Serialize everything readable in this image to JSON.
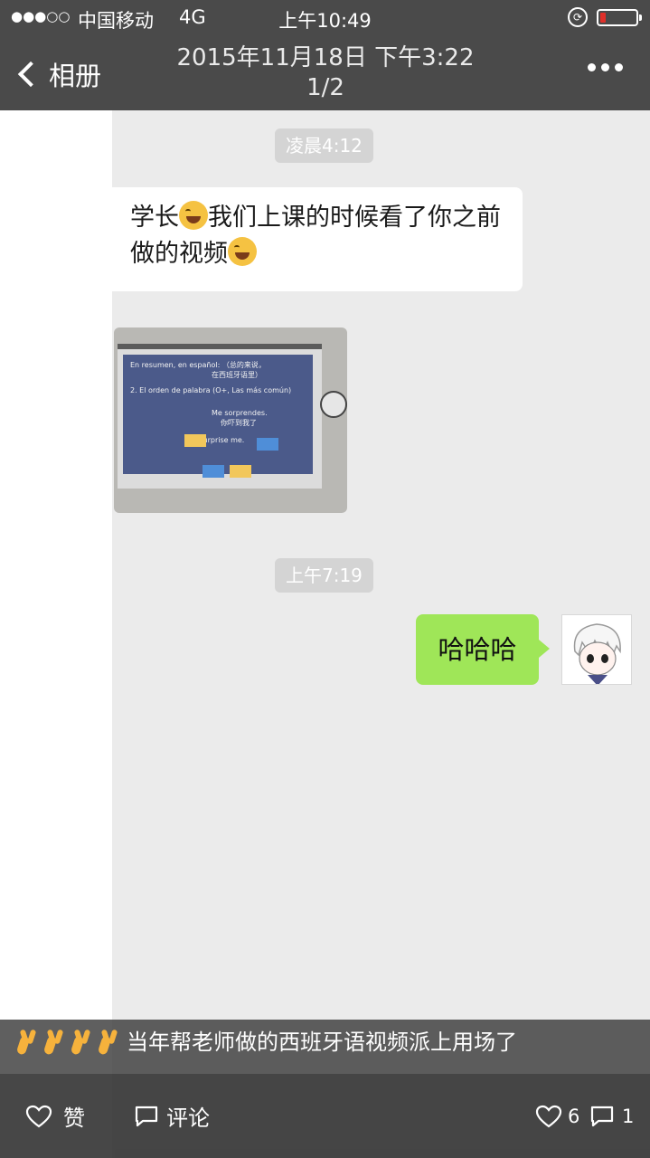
{
  "status_bar": {
    "signal": "●●●○○",
    "carrier": "中国移动",
    "network": "4G",
    "time": "上午10:49",
    "battery_level": 0.15
  },
  "header": {
    "back_label": "相册",
    "title_line1": "2015年11月18日 下午3:22",
    "title_line2": "1/2"
  },
  "chat": {
    "time1": "凌晨4:12",
    "message_left_part1": "学长",
    "message_left_part2": "我们上课的时候看了你之前做的视频",
    "slide_text": {
      "line1": "En resumen, en español: （总的来说，",
      "line2": "在西班牙语里）",
      "line3": "2. El orden de palabra (O+, Las más común)",
      "line4": "Me sorprendes.",
      "line5": "你吓到我了",
      "line6": "You surprise me."
    },
    "time2": "上午7:19",
    "message_right": "哈哈哈"
  },
  "caption": "当年帮老师做的西班牙语视频派上用场了",
  "toolbar": {
    "like_label": "赞",
    "comment_label": "评论",
    "like_count": "6",
    "comment_count": "1"
  }
}
